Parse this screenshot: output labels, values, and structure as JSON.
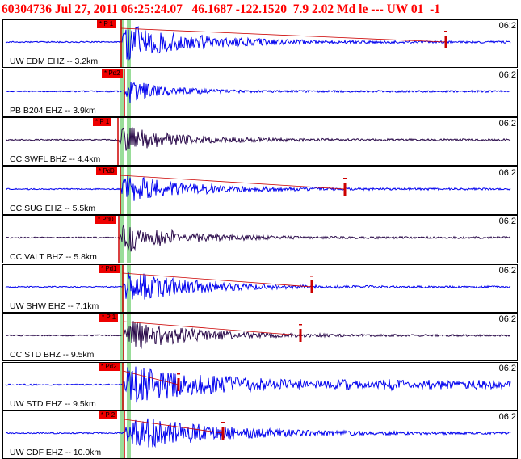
{
  "header": {
    "text": "60304736 Jul 27, 2011 06:25:24.07   46.1687 -122.1520  7.9 2.02 Md le --- UW 01  -1"
  },
  "colors": {
    "header_text": "#ff0000",
    "trace_blue": "#0000ee",
    "trace_dark": "#2a0a4a",
    "pick_flag": "#ee0000",
    "pick_line": "#cc0000",
    "green_band": "#99dd99",
    "coda_line": "#cc0000"
  },
  "traces": [
    {
      "label": "UW EDM EHZ -- 3.2km",
      "time_label": "06:2",
      "pick": "* P 1",
      "pick_icon": "pick-flag",
      "color": "blue",
      "amp": 1.0,
      "duration": 0.55,
      "has_coda": true,
      "coda_end": 0.86
    },
    {
      "label": "PB B204 EHZ -- 3.9km",
      "time_label": "06:2",
      "pick": "* Pd2",
      "pick_icon": "pick-flag",
      "color": "blue",
      "amp": 0.65,
      "duration": 0.3,
      "has_coda": false
    },
    {
      "label": "CC SWFL BHZ -- 4.4km",
      "time_label": "06:2",
      "pick": "* P 1",
      "pick_icon": "pick-flag",
      "color": "dark",
      "amp": 0.75,
      "duration": 0.45,
      "has_coda": false
    },
    {
      "label": "CC SUG EHZ -- 5.5km",
      "time_label": "06:2",
      "pick": "* Pd0",
      "pick_icon": "pick-flag",
      "color": "blue",
      "amp": 0.8,
      "duration": 0.5,
      "has_coda": true,
      "coda_end": 0.66
    },
    {
      "label": "CC VALT BHZ -- 5.8km",
      "time_label": "06:2",
      "pick": "* Pd0",
      "pick_icon": "pick-flag",
      "color": "dark",
      "amp": 0.85,
      "duration": 0.45,
      "has_coda": false
    },
    {
      "label": "UW SHW EHZ -- 7.1km",
      "time_label": "06:2",
      "pick": "* Pd1",
      "pick_icon": "pick-flag",
      "color": "blue",
      "amp": 0.9,
      "duration": 0.5,
      "has_coda": true,
      "coda_end": 0.6
    },
    {
      "label": "CC STD BHZ -- 9.5km",
      "time_label": "06:2",
      "pick": "* P 1",
      "pick_icon": "pick-flag",
      "color": "dark",
      "amp": 0.9,
      "duration": 0.5,
      "has_coda": true,
      "coda_end": 0.58
    },
    {
      "label": "UW STD EHZ -- 9.5km",
      "time_label": "06:2",
      "pick": "* Pd2",
      "pick_icon": "pick-flag",
      "color": "blue",
      "amp": 1.0,
      "duration": 0.9,
      "has_coda": true,
      "coda_end": 0.34
    },
    {
      "label": "UW CDF EHZ -- 10.0km",
      "time_label": "06:2",
      "pick": "* P 2",
      "pick_icon": "pick-flag",
      "color": "blue",
      "amp": 1.0,
      "duration": 0.7,
      "has_coda": true,
      "coda_end": 0.42
    }
  ]
}
